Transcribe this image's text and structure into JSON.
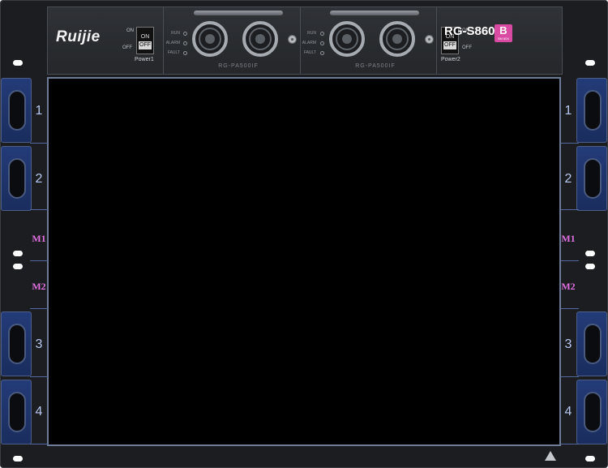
{
  "brand": {
    "logo_text": "Ruijie",
    "model": "RG-S8606",
    "badge_letter": "B",
    "badge_sub": "SM 80X"
  },
  "power1": {
    "on_label": "ON",
    "off_label": "OFF",
    "switch_on": "ON",
    "switch_off": "OFF",
    "name": "Power1"
  },
  "power2": {
    "on_label": "ON",
    "off_label": "OFF",
    "switch_on": "ON",
    "switch_off": "OFF",
    "name": "Power2"
  },
  "psu1": {
    "model": "RG-PA500IF",
    "led_run": "RUN",
    "led_alarm": "ALARM",
    "led_fault": "FAULT"
  },
  "psu2": {
    "model": "RG-PA500IF",
    "led_run": "RUN",
    "led_alarm": "ALARM",
    "led_fault": "FAULT"
  },
  "left_slots": [
    {
      "label": "1"
    },
    {
      "label": "2"
    },
    {
      "label": "M1"
    },
    {
      "label": "M2"
    },
    {
      "label": "3"
    },
    {
      "label": "4"
    }
  ],
  "right_slots": [
    {
      "label": "1"
    },
    {
      "label": "2"
    },
    {
      "label": "M1"
    },
    {
      "label": "M2"
    },
    {
      "label": "3"
    },
    {
      "label": "4"
    }
  ],
  "colors": {
    "chassis": "#1b1d20",
    "slot_blue": "#1f3570",
    "mgmt_pink": "#e070e0",
    "badge": "#d94aa3"
  }
}
